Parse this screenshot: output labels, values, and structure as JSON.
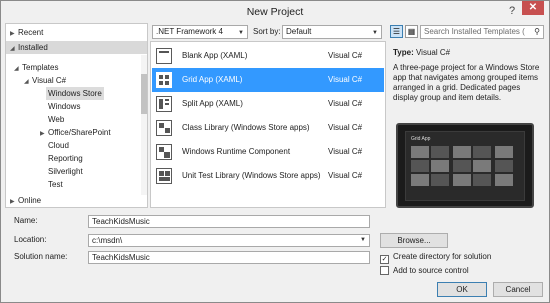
{
  "window": {
    "title": "New Project",
    "help_glyph": "?",
    "close_glyph": "✕"
  },
  "tree": {
    "recent": "Recent",
    "installed": "Installed",
    "templates": "Templates",
    "visual_csharp": "Visual C#",
    "items": [
      "Windows Store",
      "Windows",
      "Web",
      "Office/SharePoint",
      "Cloud",
      "Reporting",
      "Silverlight",
      "Test"
    ],
    "online": "Online"
  },
  "toolbar": {
    "framework": ".NET Framework 4",
    "sort_label": "Sort by:",
    "sort_value": "Default",
    "search_placeholder": "Search Installed Templates (",
    "search_icon": "search-icon"
  },
  "templates": [
    {
      "name": "Blank App (XAML)",
      "lang": "Visual C#",
      "icon": "blank-app-icon"
    },
    {
      "name": "Grid App (XAML)",
      "lang": "Visual C#",
      "icon": "grid-app-icon",
      "selected": true
    },
    {
      "name": "Split App (XAML)",
      "lang": "Visual C#",
      "icon": "split-app-icon"
    },
    {
      "name": "Class Library (Windows Store apps)",
      "lang": "Visual C#",
      "icon": "class-library-icon"
    },
    {
      "name": "Windows Runtime Component",
      "lang": "Visual C#",
      "icon": "runtime-component-icon"
    },
    {
      "name": "Unit Test Library (Windows Store apps)",
      "lang": "Visual C#",
      "icon": "unit-test-icon"
    }
  ],
  "details": {
    "type_label": "Type:",
    "type_value": "Visual C#",
    "description": "A three-page project for a Windows Store app that navigates among grouped items arranged in a grid. Dedicated pages display group and item details.",
    "preview_title": "Grid App"
  },
  "form": {
    "name_label": "Name:",
    "name_value": "TeachKidsMusic",
    "location_label": "Location:",
    "location_value": "c:\\msdn\\",
    "solution_label": "Solution name:",
    "solution_value": "TeachKidsMusic",
    "browse": "Browse...",
    "create_dir": "Create directory for solution",
    "create_dir_checked": true,
    "source_control": "Add to source control",
    "source_control_checked": false,
    "ok": "OK",
    "cancel": "Cancel"
  },
  "colors": {
    "selection": "#3399ff",
    "close": "#c75050"
  }
}
